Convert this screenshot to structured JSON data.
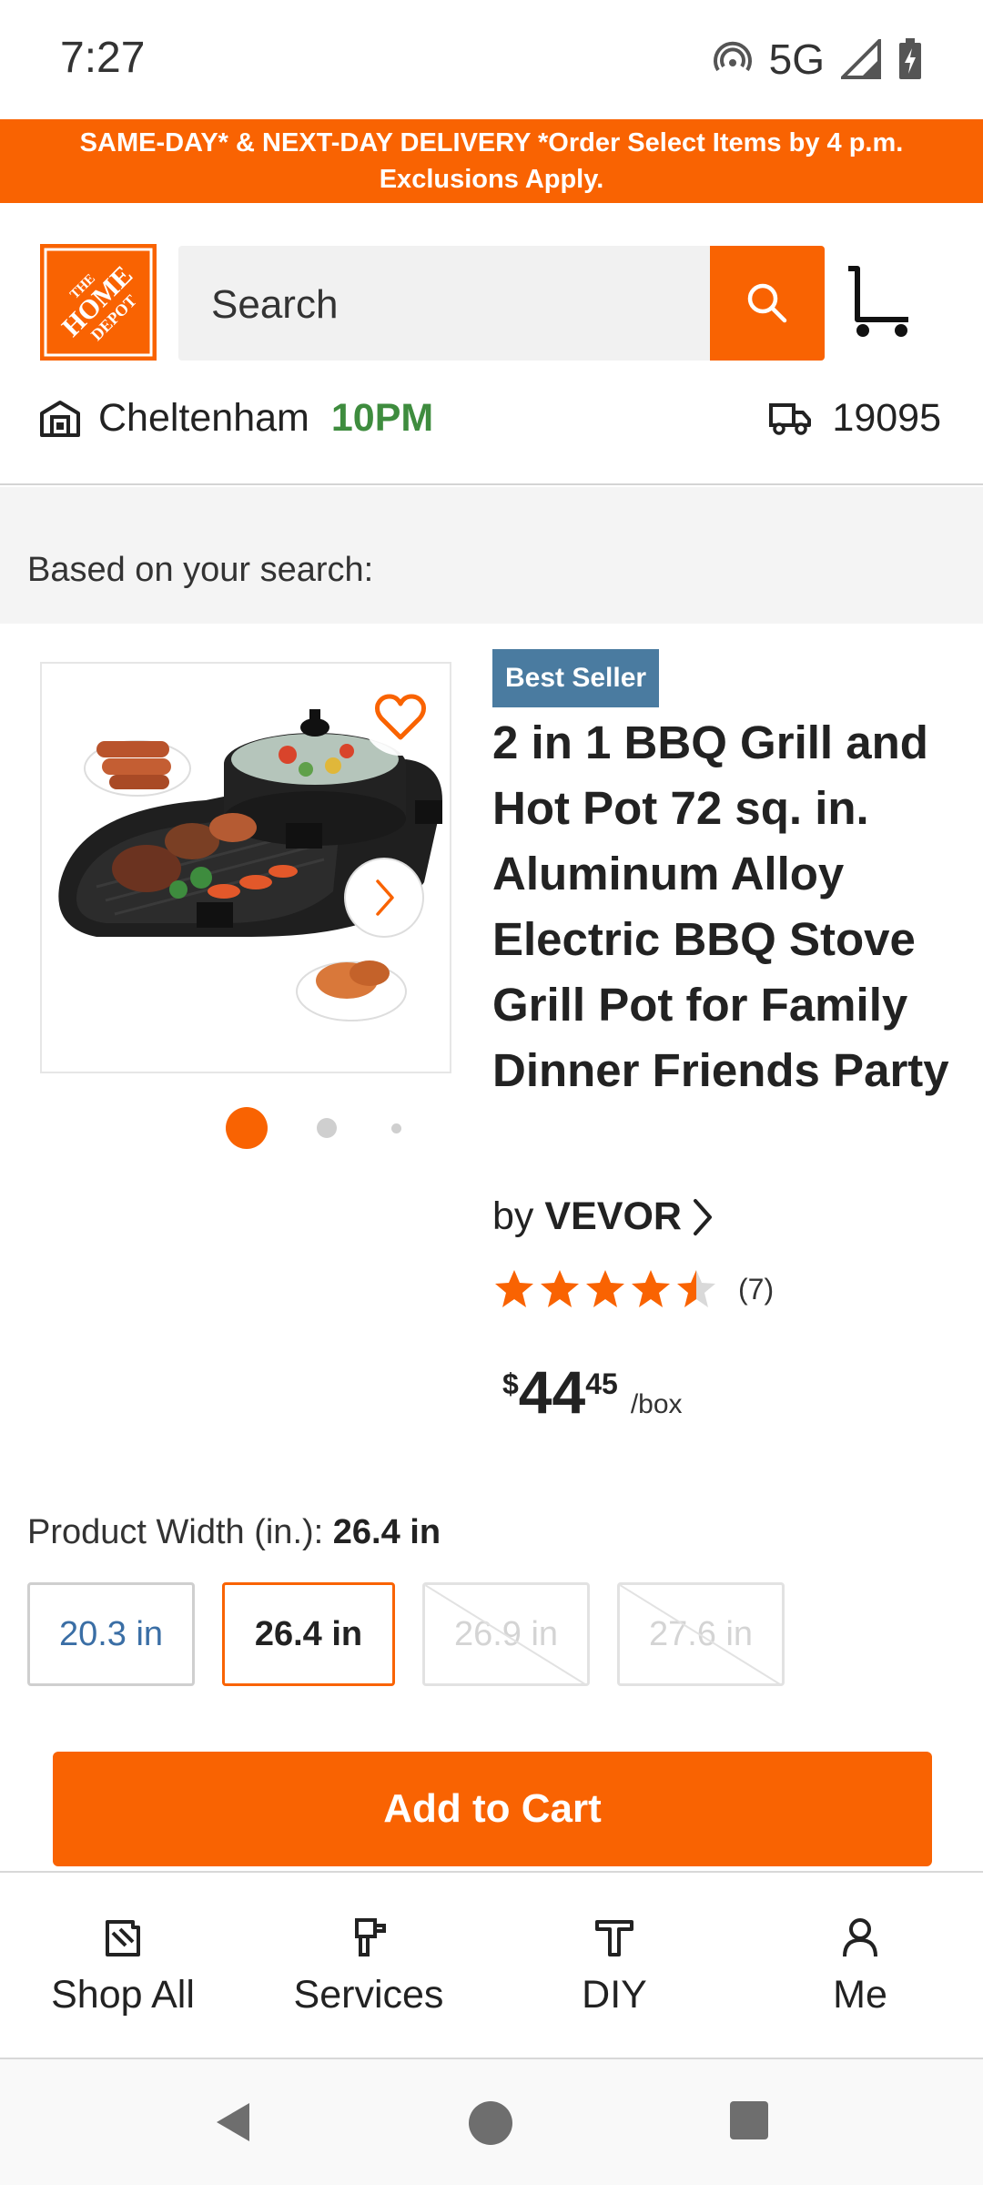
{
  "status_bar": {
    "time": "7:27",
    "network": "5G"
  },
  "promo": {
    "line1": "SAME-DAY* & NEXT-DAY DELIVERY *Order Select Items by 4 p.m.",
    "line2": "Exclusions Apply."
  },
  "header": {
    "logo_text": [
      "THE",
      "HOME",
      "DEPOT"
    ],
    "search_placeholder": "Search",
    "store_name": "Cheltenham",
    "store_hours": "10PM",
    "zip": "19095"
  },
  "section": {
    "label": "Based on your search:"
  },
  "product": {
    "badge": "Best Seller",
    "title": "2 in 1 BBQ Grill and Hot Pot 72 sq. in. Aluminum Alloy Electric BBQ Stove Grill Pot for Family Dinner Friends Party",
    "brand_prefix": "by",
    "brand": "VEVOR",
    "rating": 4.5,
    "review_count": "(7)",
    "price_currency": "$",
    "price_dollars": "44",
    "price_cents": "45",
    "price_unit": "/box",
    "image_count": 3,
    "active_image": 1
  },
  "width_selector": {
    "label": "Product Width (in.):",
    "selected_value": "26.4 in",
    "options": [
      {
        "label": "20.3 in",
        "state": "available"
      },
      {
        "label": "26.4 in",
        "state": "selected"
      },
      {
        "label": "26.9 in",
        "state": "unavailable"
      },
      {
        "label": "27.6 in",
        "state": "unavailable"
      }
    ]
  },
  "add_to_cart_label": "Add to Cart",
  "bottom_nav": [
    {
      "label": "Shop All",
      "icon": "shop-all-icon"
    },
    {
      "label": "Services",
      "icon": "services-icon"
    },
    {
      "label": "DIY",
      "icon": "diy-icon"
    },
    {
      "label": "Me",
      "icon": "me-icon"
    }
  ],
  "colors": {
    "brand_orange": "#f96302",
    "hours_green": "#3e8c3e",
    "badge_blue": "#4a7ba0",
    "link_blue": "#3a6ea5"
  }
}
